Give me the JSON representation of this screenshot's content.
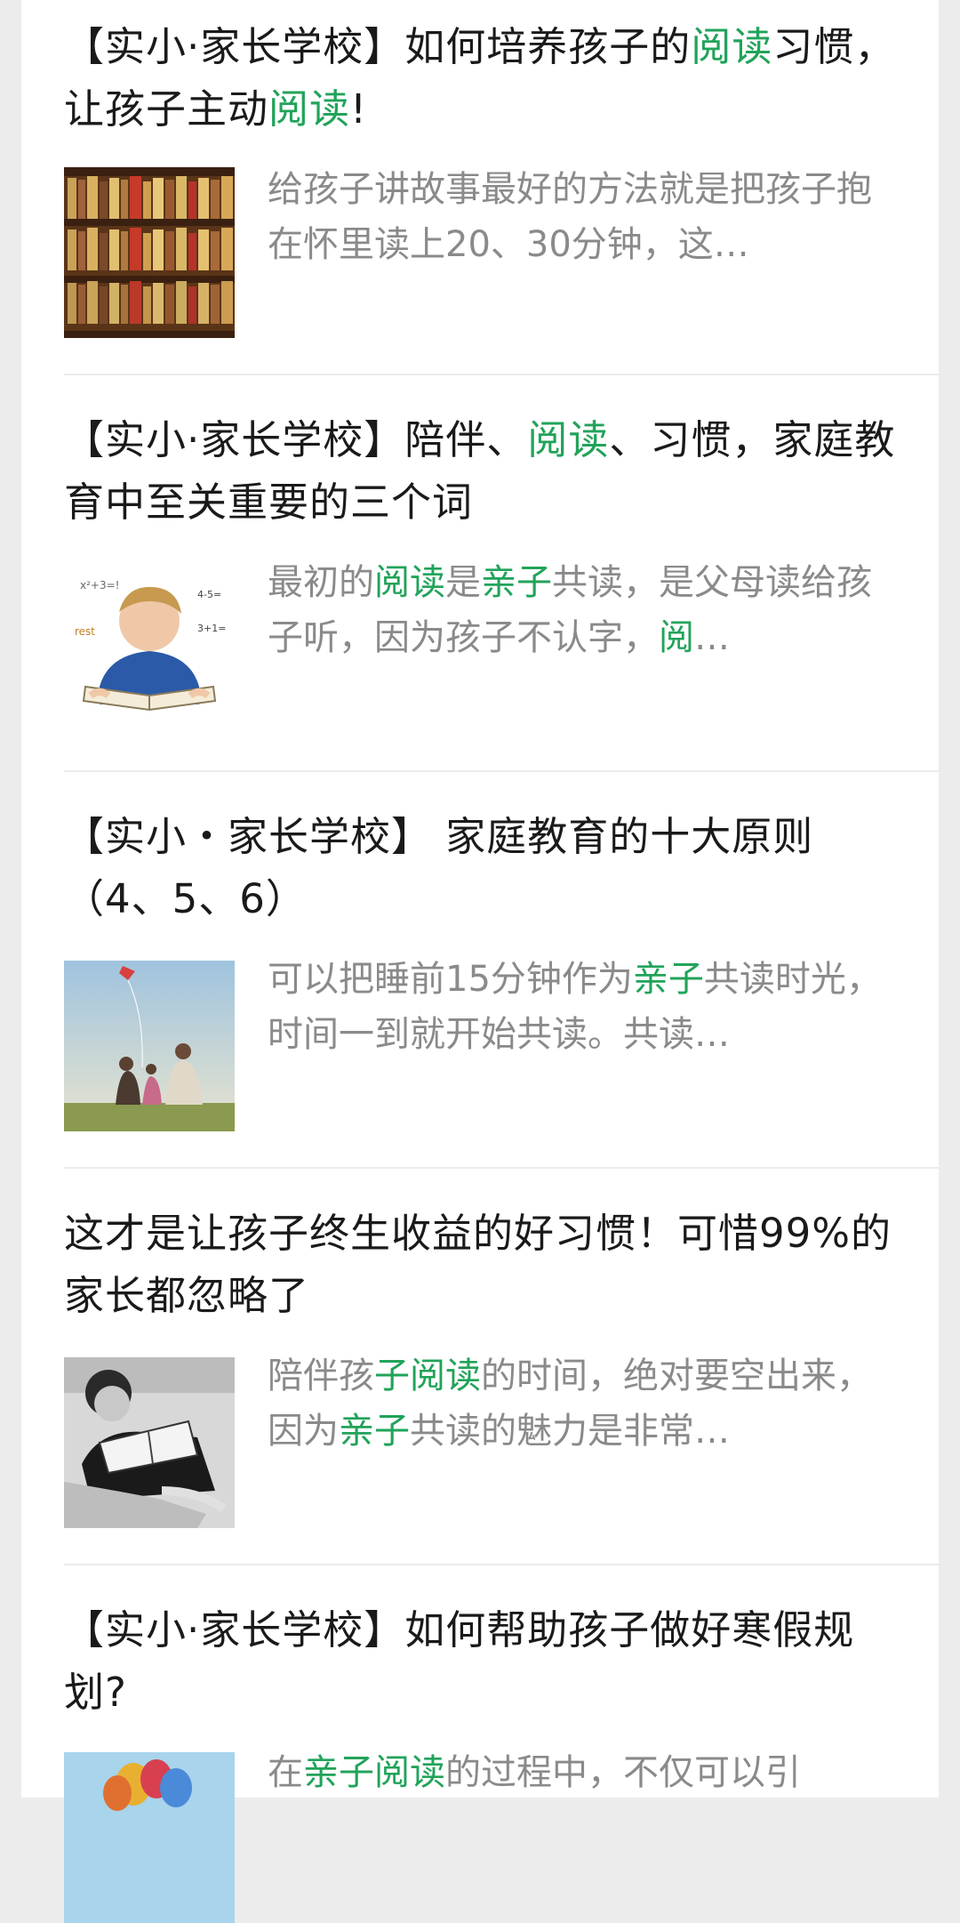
{
  "items": [
    {
      "title": [
        {
          "t": "【实小·家长学校】如何培养孩子的",
          "hl": false
        },
        {
          "t": "阅读",
          "hl": true
        },
        {
          "t": "习惯，让孩子主动",
          "hl": false
        },
        {
          "t": "阅读",
          "hl": true
        },
        {
          "t": "!",
          "hl": false
        }
      ],
      "desc": [
        {
          "t": "给孩子讲故事最好的方法就是把孩子抱在怀里读上20、30分钟，这…",
          "hl": false
        }
      ],
      "thumb_icon": "bookshelf-image"
    },
    {
      "title": [
        {
          "t": "【实小·家长学校】陪伴、",
          "hl": false
        },
        {
          "t": "阅读",
          "hl": true
        },
        {
          "t": "、习惯，家庭教育中至关重要的三个词",
          "hl": false
        }
      ],
      "desc": [
        {
          "t": "最初的",
          "hl": false
        },
        {
          "t": "阅读",
          "hl": true
        },
        {
          "t": "是",
          "hl": false
        },
        {
          "t": "亲子",
          "hl": true
        },
        {
          "t": "共读，是父母读给孩子听，因为孩子不认字，",
          "hl": false
        },
        {
          "t": "阅",
          "hl": true
        },
        {
          "t": "…",
          "hl": false
        }
      ],
      "thumb_icon": "boy-reading-image"
    },
    {
      "title": [
        {
          "t": "【实小・家长学校】 家庭教育的十大原则（4、5、6）",
          "hl": false
        }
      ],
      "desc": [
        {
          "t": "可以把睡前15分钟作为",
          "hl": false
        },
        {
          "t": "亲子",
          "hl": true
        },
        {
          "t": "共读时光，时间一到就开始共读。共读…",
          "hl": false
        }
      ],
      "thumb_icon": "family-kite-image"
    },
    {
      "title": [
        {
          "t": "这才是让孩子终生收益的好习惯！可惜99%的家长都忽略了",
          "hl": false
        }
      ],
      "desc": [
        {
          "t": "陪伴孩",
          "hl": false
        },
        {
          "t": "子阅读",
          "hl": true
        },
        {
          "t": "的时间，绝对要空出来，因为",
          "hl": false
        },
        {
          "t": "亲子",
          "hl": true
        },
        {
          "t": "共读的魅力是非常…",
          "hl": false
        }
      ],
      "thumb_icon": "child-book-bw-image"
    },
    {
      "title": [
        {
          "t": "【实小·家长学校】如何帮助孩子做好寒假规划?",
          "hl": false
        }
      ],
      "desc": [
        {
          "t": "在",
          "hl": false
        },
        {
          "t": "亲子阅读",
          "hl": true
        },
        {
          "t": "的过程中，不仅可以引",
          "hl": false
        }
      ],
      "thumb_icon": "balloons-image"
    }
  ],
  "colors": {
    "background": "#ececec",
    "card": "#ffffff",
    "title_text": "#1a1a1a",
    "desc_text": "#8a8a8a",
    "highlight": "#21a35a"
  }
}
